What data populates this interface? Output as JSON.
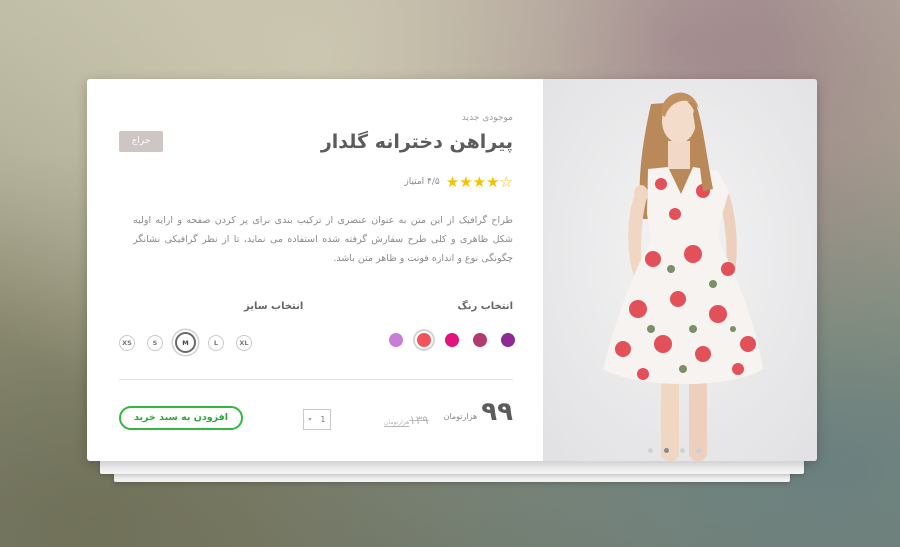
{
  "product": {
    "eyebrow": "موجودی جدید",
    "title": "پیراهن دخترانه گلدار",
    "sale_badge": "حراج",
    "rating_text": "۴/۵ امتیاز",
    "stars": "★★★★☆",
    "description": "طراح گرافیک از این متن به عنوان عنصری از ترکیب بندی برای پر کردن صفحه و ارایه اولیه شکل ظاهری و کلی طرح سفارش گرفته شده استفاده می نماید، تا از نظر گرافیکی نشانگر چگونگی نوع و اندازه فونت و ظاهر متن باشد."
  },
  "color_picker": {
    "label": "انتخاب رنگ",
    "colors": [
      "#8e2a96",
      "#b23a6f",
      "#e3137e",
      "#f2545b",
      "#c67fd6"
    ],
    "selected_index": 3
  },
  "size_picker": {
    "label": "انتخاب سایز",
    "sizes": [
      "XS",
      "S",
      "M",
      "L",
      "XL"
    ],
    "selected": "M"
  },
  "pricing": {
    "price": "۹۹",
    "unit": "هزارتومان",
    "old_price": "۱۳۹",
    "old_unit": "هزارتومان"
  },
  "quantity": {
    "value": "1",
    "arrow": "▾"
  },
  "cart_button": {
    "label": "افزودن به سبد خرید"
  },
  "gallery": {
    "slide_count": 4,
    "active_slide": 2
  }
}
